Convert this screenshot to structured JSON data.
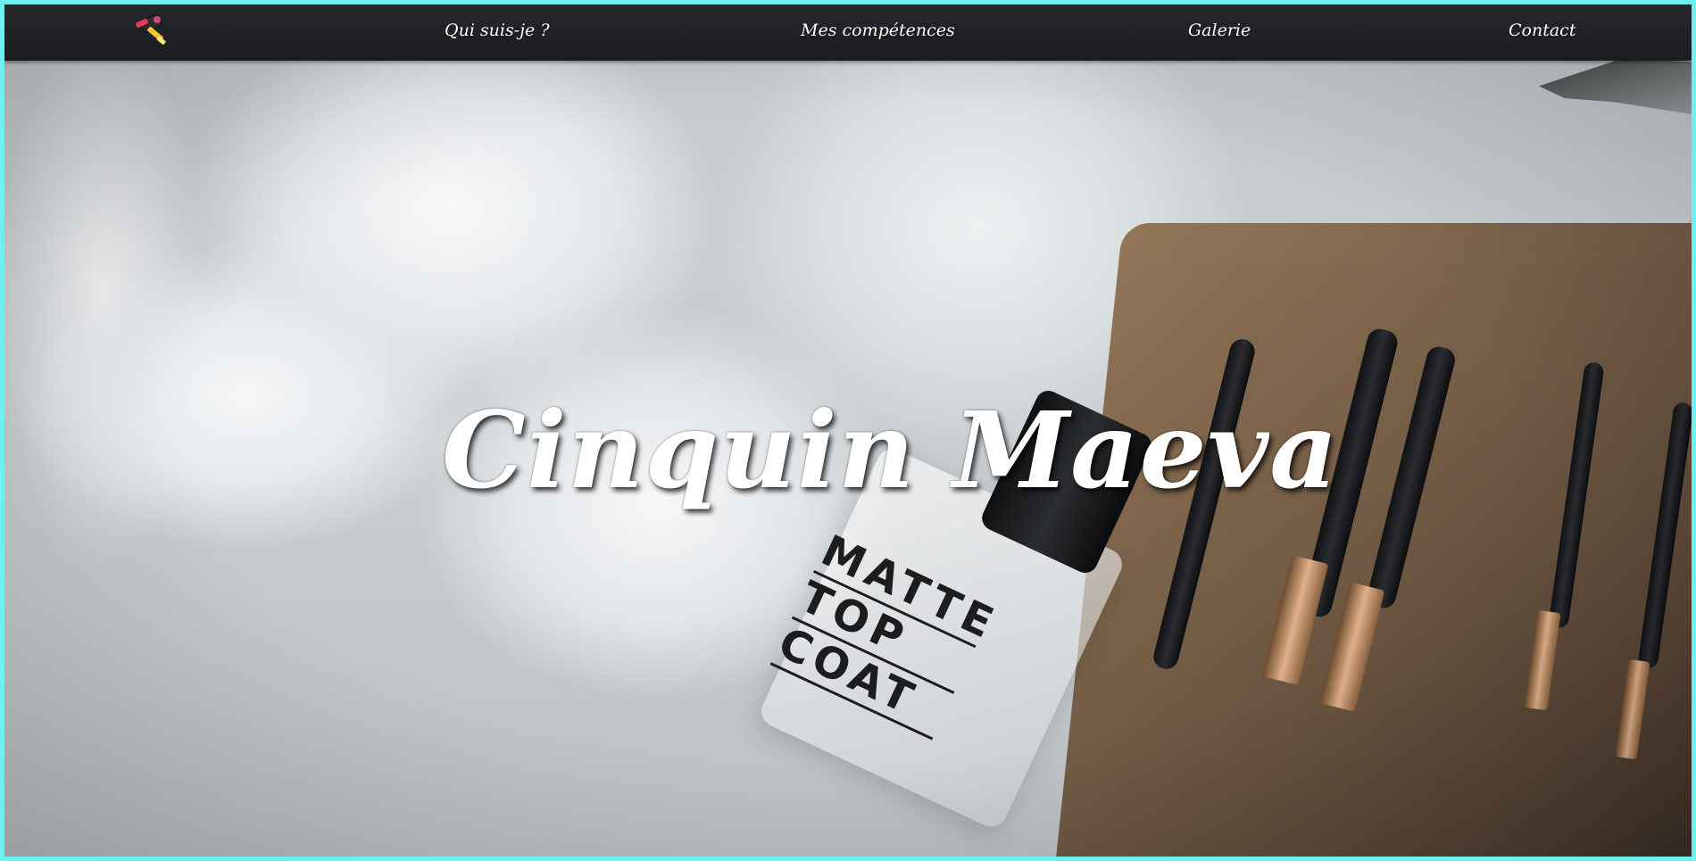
{
  "site": {
    "title": "Cinquin Maeva"
  },
  "nav": {
    "logo_icon": "makeup-kit-icon",
    "items": [
      {
        "label": "Qui suis-je ?"
      },
      {
        "label": "Mes compétences"
      },
      {
        "label": "Galerie"
      },
      {
        "label": "Contact"
      }
    ]
  },
  "hero": {
    "product_label_lines": [
      "MATTE",
      "TOP",
      "COAT"
    ]
  },
  "colors": {
    "navbar": "#1f2123",
    "frame_border": "#6ff0f0",
    "text": "#ffffff"
  }
}
